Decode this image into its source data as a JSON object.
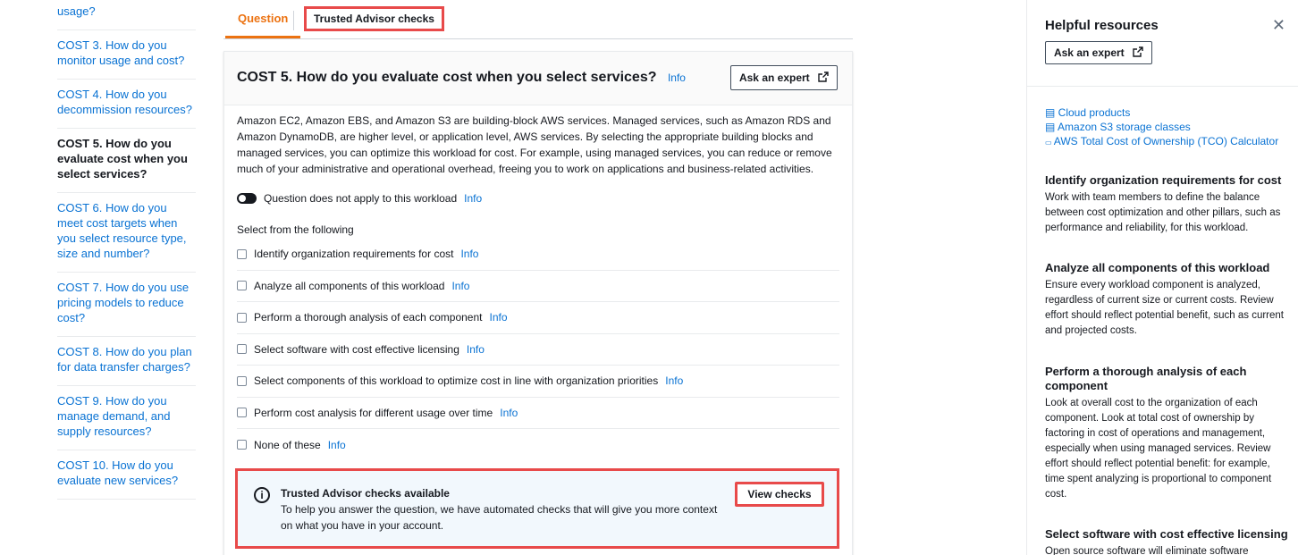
{
  "nav": {
    "items": [
      {
        "label": "usage?",
        "active": false
      },
      {
        "label": "COST 3. How do you monitor usage and cost?",
        "active": false
      },
      {
        "label": "COST 4. How do you decommission resources?",
        "active": false
      },
      {
        "label": "COST 5. How do you evaluate cost when you select services?",
        "active": true
      },
      {
        "label": "COST 6. How do you meet cost targets when you select resource type, size and number?",
        "active": false
      },
      {
        "label": "COST 7. How do you use pricing models to reduce cost?",
        "active": false
      },
      {
        "label": "COST 8. How do you plan for data transfer charges?",
        "active": false
      },
      {
        "label": "COST 9. How do you manage demand, and supply resources?",
        "active": false
      },
      {
        "label": "COST 10. How do you evaluate new services?",
        "active": false
      }
    ]
  },
  "tabs": {
    "question": "Question",
    "trusted_advisor": "Trusted Advisor checks"
  },
  "question": {
    "title": "COST 5. How do you evaluate cost when you select services?",
    "info": "Info",
    "ask_expert": "Ask an expert",
    "description": "Amazon EC2, Amazon EBS, and Amazon S3 are building-block AWS services. Managed services, such as Amazon RDS and Amazon DynamoDB, are higher level, or application level, AWS services. By selecting the appropriate building blocks and managed services, you can optimize this workload for cost. For example, using managed services, you can reduce or remove much of your administrative and operational overhead, freeing you to work on applications and business-related activities.",
    "toggle_label": "Question does not apply to this workload",
    "select_label": "Select from the following",
    "choices": [
      "Identify organization requirements for cost",
      "Analyze all components of this workload",
      "Perform a thorough analysis of each component",
      "Select software with cost effective licensing",
      "Select components of this workload to optimize cost in line with organization priorities",
      "Perform cost analysis for different usage over time",
      "None of these"
    ]
  },
  "trusted_advisor_box": {
    "icon": "i",
    "title": "Trusted Advisor checks available",
    "body": "To help you answer the question, we have automated checks that will give you more context on what you have in your account.",
    "button": "View checks"
  },
  "helpful": {
    "title": "Helpful resources",
    "close": "✕",
    "ask_expert": "Ask an expert",
    "links": [
      "Cloud products",
      "Amazon S3 storage classes",
      "AWS Total Cost of Ownership (TCO) Calculator"
    ],
    "sections": [
      {
        "heading": "Identify organization requirements for cost",
        "text": "Work with team members to define the balance between cost optimization and other pillars, such as performance and reliability, for this workload."
      },
      {
        "heading": "Analyze all components of this workload",
        "text": "Ensure every workload component is analyzed, regardless of current size or current costs. Review effort should reflect potential benefit, such as current and projected costs."
      },
      {
        "heading": "Perform a thorough analysis of each component",
        "text": "Look at overall cost to the organization of each component. Look at total cost of ownership by factoring in cost of operations and management, especially when using managed services. Review effort should reflect potential benefit: for example, time spent analyzing is proportional to component cost."
      },
      {
        "heading": "Select software with cost effective licensing",
        "text": "Open source software will eliminate software"
      }
    ]
  }
}
